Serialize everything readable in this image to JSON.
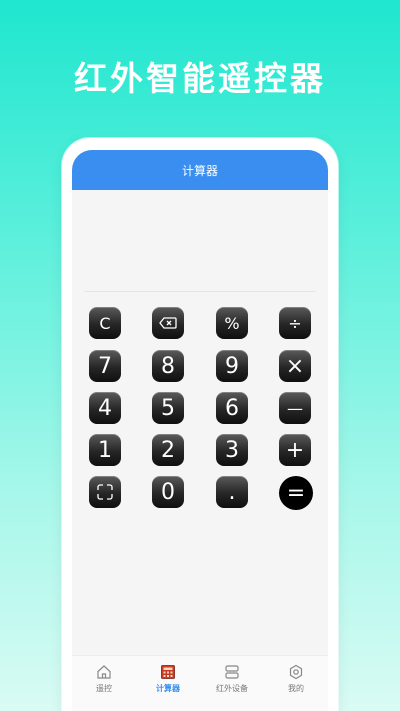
{
  "headline": "红外智能遥控器",
  "titlebar": {
    "title": "计算器"
  },
  "keys": {
    "clear": "C",
    "percent": "%",
    "divide": "÷",
    "seven": "7",
    "eight": "8",
    "nine": "9",
    "multiply": "×",
    "four": "4",
    "five": "5",
    "six": "6",
    "minus": "—",
    "one": "1",
    "two": "2",
    "three": "3",
    "plus": "+",
    "zero": "0",
    "dot": ".",
    "equals": "="
  },
  "tabbar": {
    "items": [
      {
        "label": "遥控",
        "icon": "home-icon"
      },
      {
        "label": "计算器",
        "icon": "calculator-icon"
      },
      {
        "label": "红外设备",
        "icon": "device-icon"
      },
      {
        "label": "我的",
        "icon": "hexagon-icon"
      }
    ],
    "active_index": 1,
    "active_color": "#3a8ef0"
  },
  "colors": {
    "titlebar": "#3a8ef0",
    "key": "#1a1a1a",
    "background_top": "#1fe6cf",
    "background_bottom": "#d9fbf4"
  }
}
